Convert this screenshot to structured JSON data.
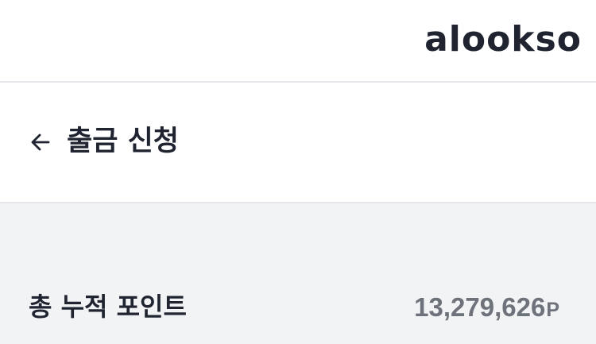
{
  "header": {
    "logo_text": "alookso"
  },
  "page": {
    "title": "출금 신청",
    "back_icon": "arrow-left-icon"
  },
  "points": {
    "label": "총 누적 포인트",
    "value": "13,279,626",
    "unit": "P"
  },
  "colors": {
    "text_primary": "#1f2430",
    "text_secondary": "#6e727a",
    "content_bg": "#f2f3f5",
    "divider": "#e6e7ea"
  }
}
